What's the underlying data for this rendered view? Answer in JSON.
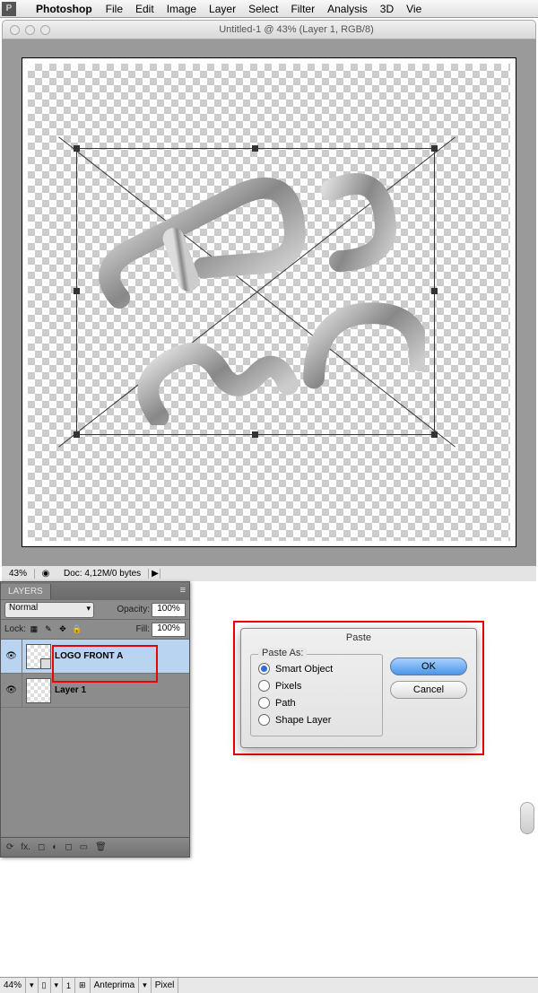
{
  "menubar": {
    "app": "Photoshop",
    "items": [
      "File",
      "Edit",
      "Image",
      "Layer",
      "Select",
      "Filter",
      "Analysis",
      "3D",
      "Vie"
    ]
  },
  "window": {
    "title": "Untitled-1 @ 43% (Layer 1, RGB/8)"
  },
  "status": {
    "zoom": "43%",
    "doc_info": "Doc: 4,12M/0 bytes",
    "arrow": "▶"
  },
  "layers": {
    "tab": "LAYERS",
    "blend_mode": "Normal",
    "opacity_label": "Opacity:",
    "opacity_value": "100%",
    "lock_label": "Lock:",
    "fill_label": "Fill:",
    "fill_value": "100%",
    "items": [
      {
        "name": "LOGO FRONT A",
        "visible": true,
        "selected": true,
        "smart": true
      },
      {
        "name": "Layer 1",
        "visible": true,
        "selected": false,
        "smart": false
      }
    ],
    "footer_icons": [
      "⟳",
      "fx.",
      "◻",
      "◐",
      "◻",
      "▭",
      "🗑"
    ]
  },
  "dialog": {
    "title": "Paste",
    "legend": "Paste As:",
    "options": [
      {
        "label": "Smart Object",
        "checked": true
      },
      {
        "label": "Pixels",
        "checked": false
      },
      {
        "label": "Path",
        "checked": false
      },
      {
        "label": "Shape Layer",
        "checked": false
      }
    ],
    "ok": "OK",
    "cancel": "Cancel"
  },
  "bottom": {
    "zoom": "44%",
    "preview": "Anteprima",
    "unit": "Pixel"
  }
}
